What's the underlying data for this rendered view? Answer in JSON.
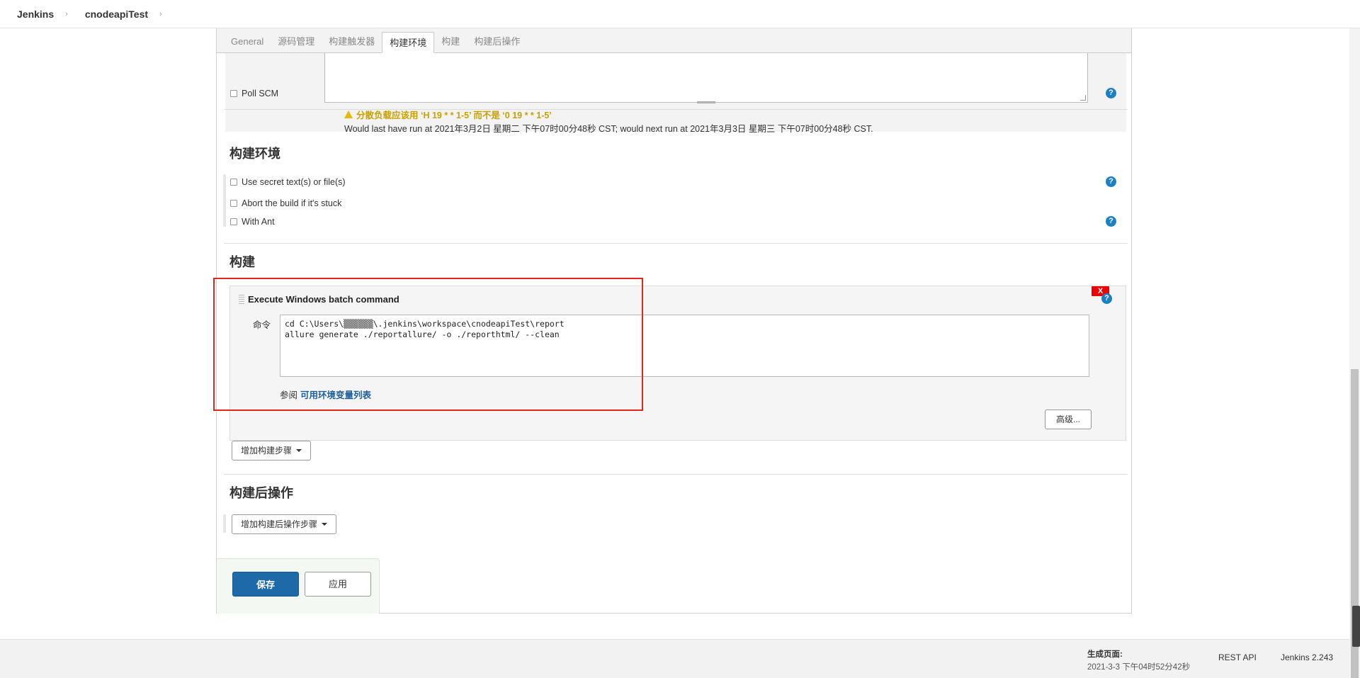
{
  "breadcrumb": {
    "root": "Jenkins",
    "project": "cnodeapiTest"
  },
  "tabs": [
    "General",
    "源码管理",
    "构建触发器",
    "构建环境",
    "构建",
    "构建后操作"
  ],
  "active_tab": "构建环境",
  "schedule": {
    "warning": "分散负载应该用 ‘H 19 * * 1-5’ 而不是 ‘0 19 * * 1-5’",
    "info": "Would last have run at 2021年3月2日 星期二 下午07时00分48秒 CST; would next run at 2021年3月3日 星期三 下午07时00分48秒 CST."
  },
  "poll_scm": "Poll SCM",
  "build_env": {
    "title": "构建环境",
    "options": [
      "Use secret text(s) or file(s)",
      "Abort the build if it's stuck",
      "With Ant"
    ]
  },
  "build": {
    "title": "构建",
    "step_title": "Execute Windows batch command",
    "close_label": "X",
    "command_label": "命令",
    "command_text": "cd C:\\Users\\▒▒▒▒▒▒\\.jenkins\\workspace\\cnodeapiTest\\report\nallure generate ./reportallure/ -o ./reporthtml/ --clean",
    "see_label": "参阅",
    "env_link": "可用环境变量列表",
    "advanced_button": "高级...",
    "add_step_button": "增加构建步骤"
  },
  "post_build": {
    "title": "构建后操作",
    "add_button": "增加构建后操作步骤"
  },
  "actions": {
    "save": "保存",
    "apply": "应用"
  },
  "footer": {
    "generated_label": "生成页面:",
    "generated_time": "2021-3-3 下午04时52分42秒",
    "rest_api": "REST API",
    "version": "Jenkins 2.243"
  },
  "help_icon_text": "?",
  "colors": {
    "accent": "#1e6aa8",
    "highlight_frame": "#e4251c",
    "help": "#1a7fc4",
    "warning": "#c9a000"
  }
}
